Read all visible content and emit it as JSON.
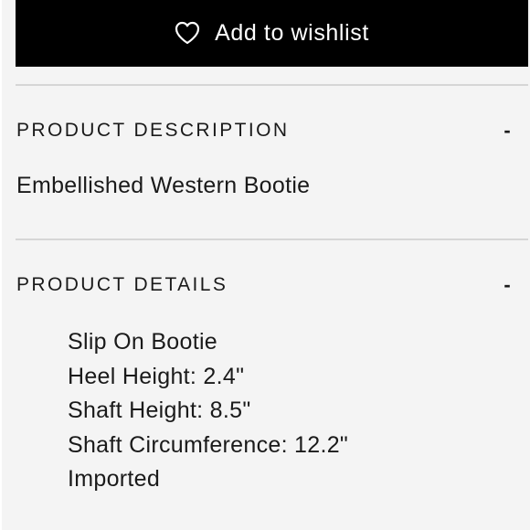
{
  "wishlist": {
    "label": "Add to wishlist",
    "icon": "heart-outline-icon"
  },
  "sections": [
    {
      "title": "PRODUCT DESCRIPTION",
      "toggle": "-",
      "text": "Embellished Western Bootie"
    },
    {
      "title": "PRODUCT DETAILS",
      "toggle": "-",
      "items": [
        "Slip On Bootie",
        "Heel Height: 2.4\"",
        "Shaft Height: 8.5\"",
        "Shaft Circumference: 12.2\"",
        "Imported"
      ]
    }
  ],
  "colors": {
    "background": "#f4f4f4",
    "button": "#000000",
    "button_text": "#ffffff",
    "divider": "#d6d6d6",
    "text": "#1a1a1a"
  }
}
